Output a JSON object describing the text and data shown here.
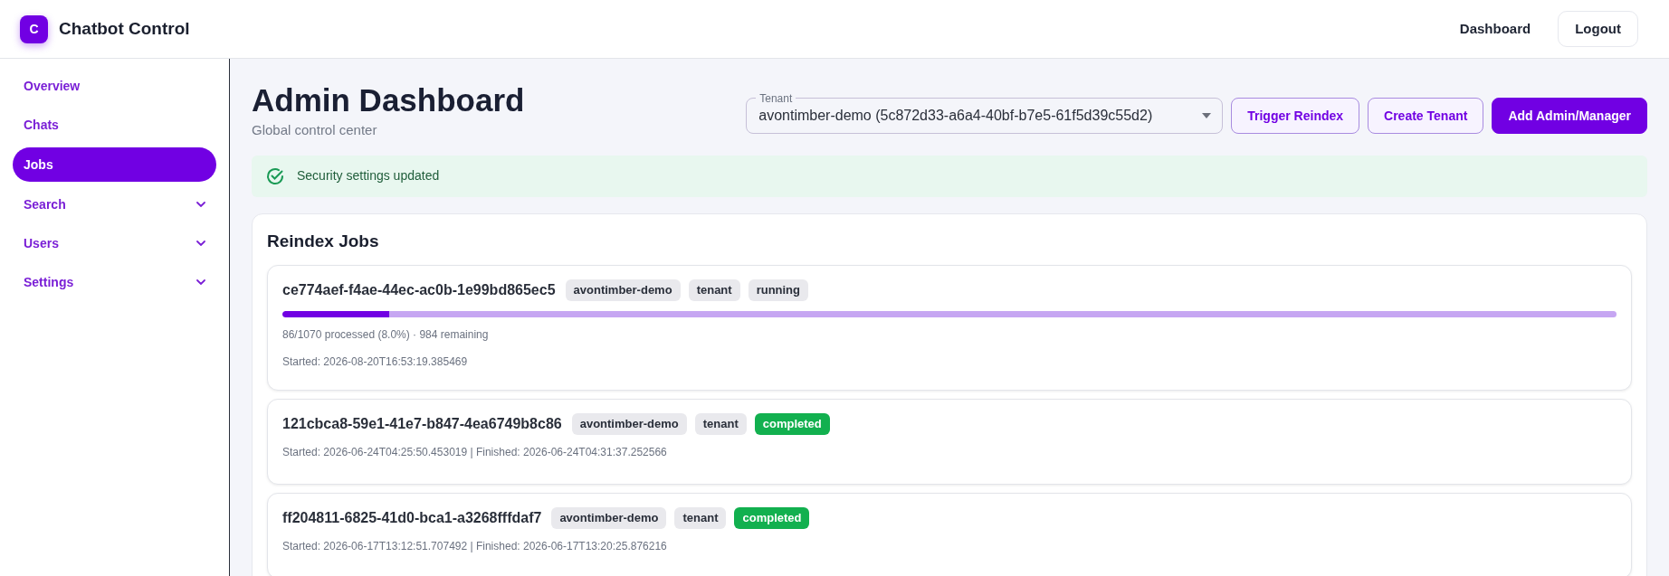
{
  "header": {
    "logo_letter": "C",
    "title": "Chatbot Control",
    "nav_link": "Dashboard",
    "logout": "Logout"
  },
  "sidebar": {
    "items": [
      {
        "label": "Overview",
        "kind": "link",
        "selected": false
      },
      {
        "label": "Chats",
        "kind": "link",
        "selected": false
      },
      {
        "label": "Jobs",
        "kind": "link",
        "selected": true
      },
      {
        "label": "Search",
        "kind": "group",
        "selected": false,
        "expanded": false
      },
      {
        "label": "Users",
        "kind": "group",
        "selected": false,
        "expanded": false
      },
      {
        "label": "Settings",
        "kind": "group",
        "selected": false,
        "expanded": false
      }
    ]
  },
  "page": {
    "title": "Admin Dashboard",
    "subtitle": "Global control center",
    "tenant_select": {
      "label": "Tenant",
      "value": "avontimber-demo (5c872d33-a6a4-40bf-b7e5-61f5d39c55d2)"
    },
    "buttons": [
      {
        "label": "Trigger Reindex",
        "kind": "outline"
      },
      {
        "label": "Create Tenant",
        "kind": "outline"
      },
      {
        "label": "Add Admin/Manager",
        "kind": "primary"
      }
    ],
    "alert": {
      "text": "Security settings updated"
    }
  },
  "jobs": {
    "title": "Reindex Jobs",
    "items": [
      {
        "id": "ce774aef-f4ae-44ec-ac0b-1e99bd865ec5",
        "tags": [
          "avontimber-demo",
          "tenant"
        ],
        "status": {
          "text": "running",
          "kind": "neutral"
        },
        "level": 0.08,
        "progress_text": "86/1070 processed (8.0%) · 984 remaining",
        "times": "Started: 2026-08-20T16:53:19.385469"
      },
      {
        "id": "121cbca8-59e1-41e7-b847-4ea6749b8c86",
        "tags": [
          "avontimber-demo",
          "tenant"
        ],
        "status": {
          "text": "completed",
          "kind": "success"
        },
        "times": "Started: 2026-06-24T04:25:50.453019 | Finished: 2026-06-24T04:31:37.252566"
      },
      {
        "id": "ff204811-6825-41d0-bca1-a3268fffdaf7",
        "tags": [
          "avontimber-demo",
          "tenant"
        ],
        "status": {
          "text": "completed",
          "kind": "success"
        },
        "times": "Started: 2026-06-17T13:12:51.707492 | Finished: 2026-06-17T13:20:25.876216"
      }
    ]
  }
}
